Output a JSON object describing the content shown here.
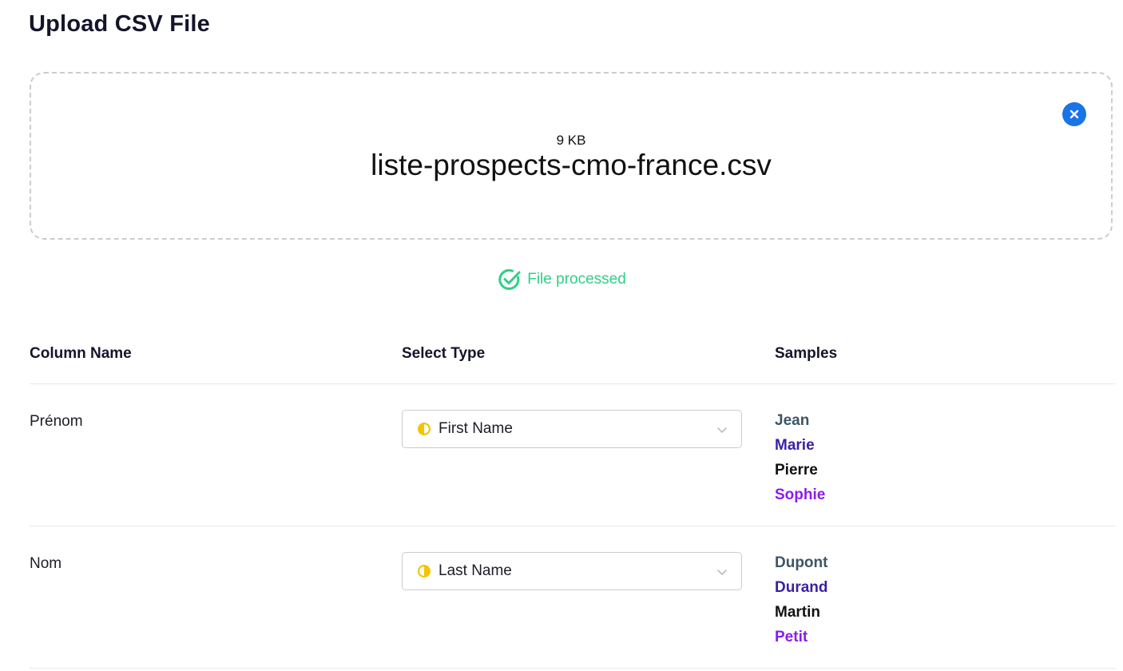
{
  "page": {
    "title": "Upload CSV File"
  },
  "upload": {
    "file_size": "9 KB",
    "file_name": "liste-prospects-cmo-france.csv",
    "remove_icon": "close-circle-icon"
  },
  "status": {
    "text": "File processed",
    "icon": "check-circle-icon",
    "color": "#2fcf86"
  },
  "table": {
    "headers": {
      "column_name": "Column Name",
      "select_type": "Select Type",
      "samples": "Samples"
    },
    "rows": [
      {
        "column_name": "Prénom",
        "type": "First Name",
        "type_icon": "half-circle-icon",
        "samples": [
          "Jean",
          "Marie",
          "Pierre",
          "Sophie"
        ]
      },
      {
        "column_name": "Nom",
        "type": "Last Name",
        "type_icon": "half-circle-icon",
        "samples": [
          "Dupont",
          "Durand",
          "Martin",
          "Petit"
        ]
      }
    ]
  },
  "colors": {
    "accent_blue": "#1a73e8",
    "type_icon_yellow": "#f5c400",
    "sample_colors": [
      "#3d5566",
      "#3b1fa3",
      "#111111",
      "#8a1cf0"
    ]
  }
}
